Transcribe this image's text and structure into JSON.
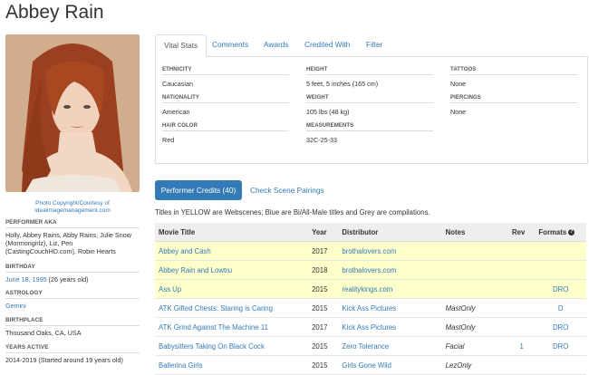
{
  "performer": {
    "name": "Abbey Rain",
    "photo_credit": "Photo Copyright/Courtesy of idealimagemanagement.com"
  },
  "sidebar": {
    "aka_label": "PERFORMER AKA",
    "aka_value": "Holly, Abbey Rains, Abby Rains, Julie Snow (Mormongirlz), Liz, Pen (CastingCouchHD.com), Robin Hearts",
    "birthday_label": "BIRTHDAY",
    "birthday_date": "June 18, 1995",
    "birthday_age": " (26 years old)",
    "astrology_label": "ASTROLOGY",
    "astrology_value": "Gemini",
    "birthplace_label": "BIRTHPLACE",
    "birthplace_value": "Thousand Oaks, CA, USA",
    "years_active_label": "YEARS ACTIVE",
    "years_active_value": "2014-2019 (Started around 19 years old)"
  },
  "tabs": [
    "Vital Stats",
    "Comments",
    "Awards",
    "Credited With",
    "Filter"
  ],
  "stats": {
    "ethnicity_label": "ETHNICITY",
    "ethnicity": "Caucasian",
    "nationality_label": "NATIONALITY",
    "nationality": "American",
    "hair_label": "HAIR COLOR",
    "hair": "Red",
    "height_label": "HEIGHT",
    "height": "5 feet, 5 inches (165 cm)",
    "weight_label": "WEIGHT",
    "weight": "105 lbs (48 kg)",
    "measurements_label": "MEASUREMENTS",
    "measurements": "32C-25-33",
    "tattoos_label": "TATTOOS",
    "tattoos": "None",
    "piercings_label": "PIERCINGS",
    "piercings": "None"
  },
  "credits": {
    "button_label": "Performer Credits (40)",
    "pairings_label": "Check Scene Pairings",
    "legend": "Titles in YELLOW are Webscenes; Blue are Bi/All-Male titles and Grey are compilations.",
    "columns": [
      "Movie Title",
      "Year",
      "Distributor",
      "Notes",
      "Rev",
      "Formats"
    ],
    "info_glyph": "?",
    "rows": [
      {
        "title": "Abbey and Cash",
        "year": "2017",
        "distributor": "brothalovers.com",
        "notes": "",
        "rev": "",
        "formats": "",
        "yellow": true
      },
      {
        "title": "Abbey Rain and Lowtru",
        "year": "2018",
        "distributor": "brothalovers.com",
        "notes": "",
        "rev": "",
        "formats": "",
        "yellow": true
      },
      {
        "title": "Ass Up",
        "year": "2015",
        "distributor": "realitykings.com",
        "notes": "",
        "rev": "",
        "formats": "DRO",
        "yellow": true
      },
      {
        "title": "ATK Gifted Chests: Staring is Caring",
        "year": "2015",
        "distributor": "Kick Ass Pictures",
        "notes": "MastOnly",
        "rev": "",
        "formats": "D",
        "yellow": false
      },
      {
        "title": "ATK Grind Against The Machine 11",
        "year": "2017",
        "distributor": "Kick Ass Pictures",
        "notes": "MastOnly",
        "rev": "",
        "formats": "DRO",
        "yellow": false
      },
      {
        "title": "Babysitters Taking On Black Cock",
        "year": "2015",
        "distributor": "Zero Tolerance",
        "notes": "Facial",
        "rev": "1",
        "formats": "DRO",
        "yellow": false
      },
      {
        "title": "Ballerina Girls",
        "year": "2015",
        "distributor": "Girls Gone Wild",
        "notes": "LezOnly",
        "rev": "",
        "formats": "",
        "yellow": false
      }
    ]
  }
}
